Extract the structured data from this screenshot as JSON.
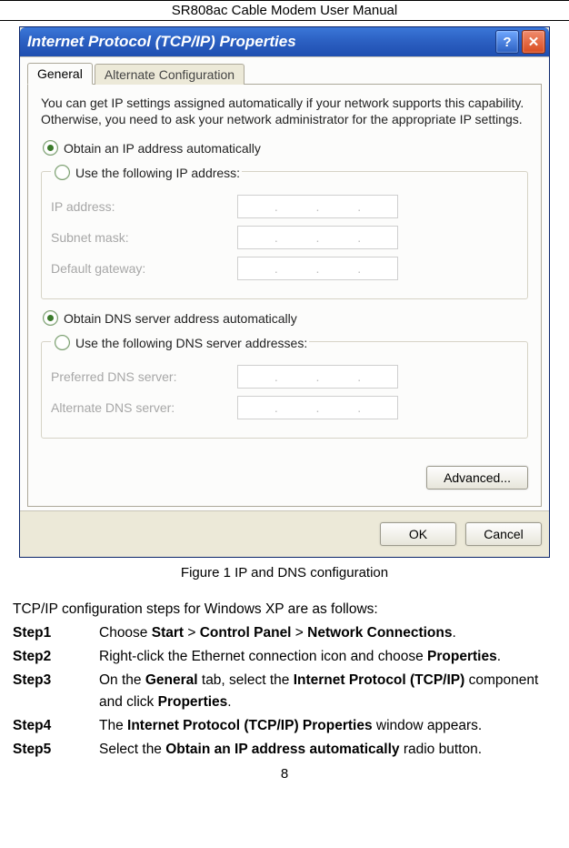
{
  "docHeader": "SR808ac Cable Modem User Manual",
  "dialog": {
    "title": "Internet Protocol (TCP/IP) Properties",
    "helpGlyph": "?",
    "closeGlyph": "✕",
    "tabs": {
      "general": "General",
      "alt": "Alternate Configuration"
    },
    "intro": "You can get IP settings assigned automatically if your network supports this capability. Otherwise, you need to ask your network administrator for the appropriate IP settings.",
    "radioAutoIP": "Obtain an IP address automatically",
    "radioUseIP": "Use the following IP address:",
    "labels": {
      "ip": "IP address:",
      "subnet": "Subnet mask:",
      "gateway": "Default gateway:",
      "prefDns": "Preferred DNS server:",
      "altDns": "Alternate DNS server:"
    },
    "radioAutoDNS": "Obtain DNS server address automatically",
    "radioUseDNS": "Use the following DNS server addresses:",
    "advanced": "Advanced...",
    "ok": "OK",
    "cancel": "Cancel"
  },
  "figureCaption": "Figure 1  IP and DNS configuration",
  "introLine": "TCP/IP configuration steps for Windows XP are as follows:",
  "steps": [
    {
      "label": "Step1",
      "pre": "Choose ",
      "bold1": "Start",
      "mid1": " > ",
      "bold2": "Control Panel",
      "mid2": " > ",
      "bold3": "Network Connections",
      "post": "."
    },
    {
      "label": "Step2",
      "pre": "Right-click the Ethernet connection icon and choose ",
      "bold1": "Properties",
      "post": "."
    },
    {
      "label": "Step3",
      "pre": "On the ",
      "bold1": "General",
      "mid1": " tab, select the ",
      "bold2": "Internet Protocol (TCP/IP)",
      "mid2": " component and click ",
      "bold3": "Properties",
      "post": "."
    },
    {
      "label": "Step4",
      "pre": "The ",
      "bold1": "Internet Protocol (TCP/IP) Properties",
      "post": " window appears."
    },
    {
      "label": "Step5",
      "pre": "Select the ",
      "bold1": "Obtain an IP address automatically",
      "post": " radio button."
    }
  ],
  "pageNumber": "8"
}
